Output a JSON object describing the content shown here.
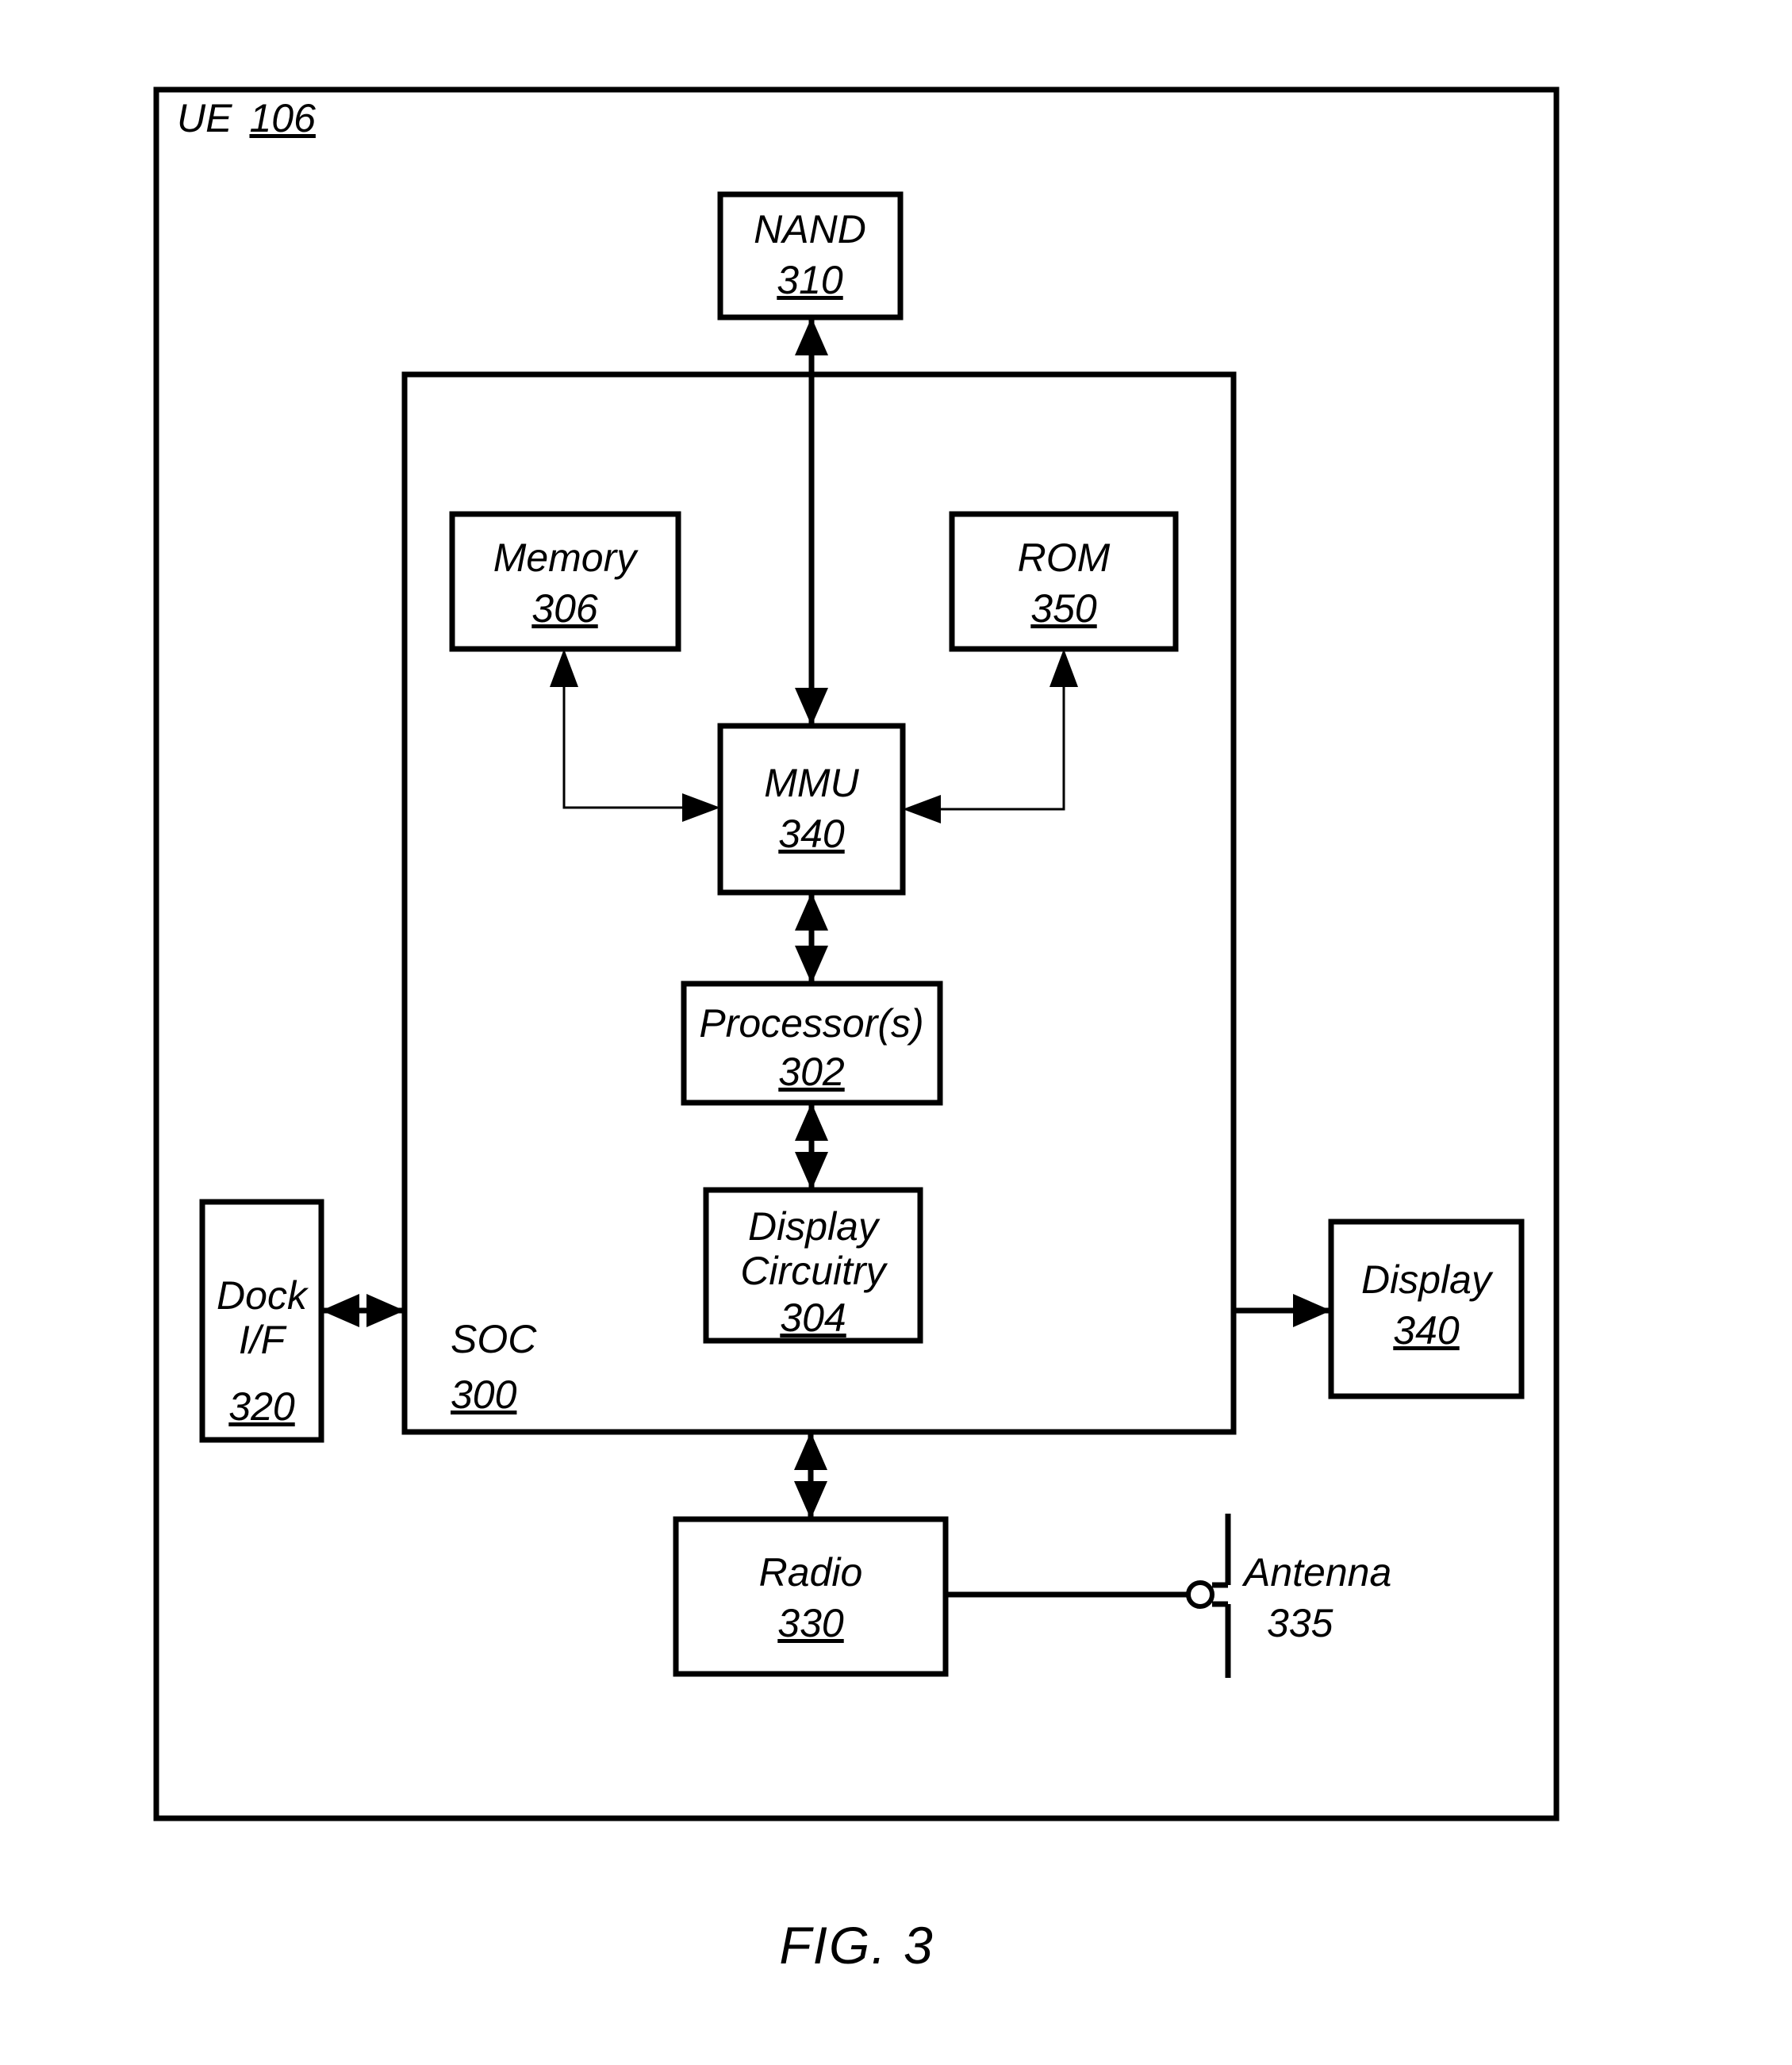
{
  "figure": {
    "caption": "FIG. 3",
    "outer": {
      "title": "UE",
      "number": "106"
    },
    "soc": {
      "title": "SOC",
      "number": "300"
    },
    "blocks": [
      {
        "key": "nand",
        "title": "NAND",
        "title2": "",
        "number": "310"
      },
      {
        "key": "memory",
        "title": "Memory",
        "title2": "",
        "number": "306"
      },
      {
        "key": "rom",
        "title": "ROM",
        "title2": "",
        "number": "350"
      },
      {
        "key": "mmu",
        "title": "MMU",
        "title2": "",
        "number": "340"
      },
      {
        "key": "processor",
        "title": "Processor(s)",
        "title2": "",
        "number": "302"
      },
      {
        "key": "dispcirc",
        "title": "Display",
        "title2": "Circuitry",
        "number": "304"
      },
      {
        "key": "dock",
        "title": "Dock",
        "title2": "I/F",
        "number": "320"
      },
      {
        "key": "display",
        "title": "Display",
        "title2": "",
        "number": "340"
      },
      {
        "key": "radio",
        "title": "Radio",
        "title2": "",
        "number": "330"
      }
    ],
    "antenna": {
      "title": "Antenna",
      "number": "335"
    },
    "colors": {
      "ink": "#000000",
      "paper": "#ffffff"
    }
  }
}
